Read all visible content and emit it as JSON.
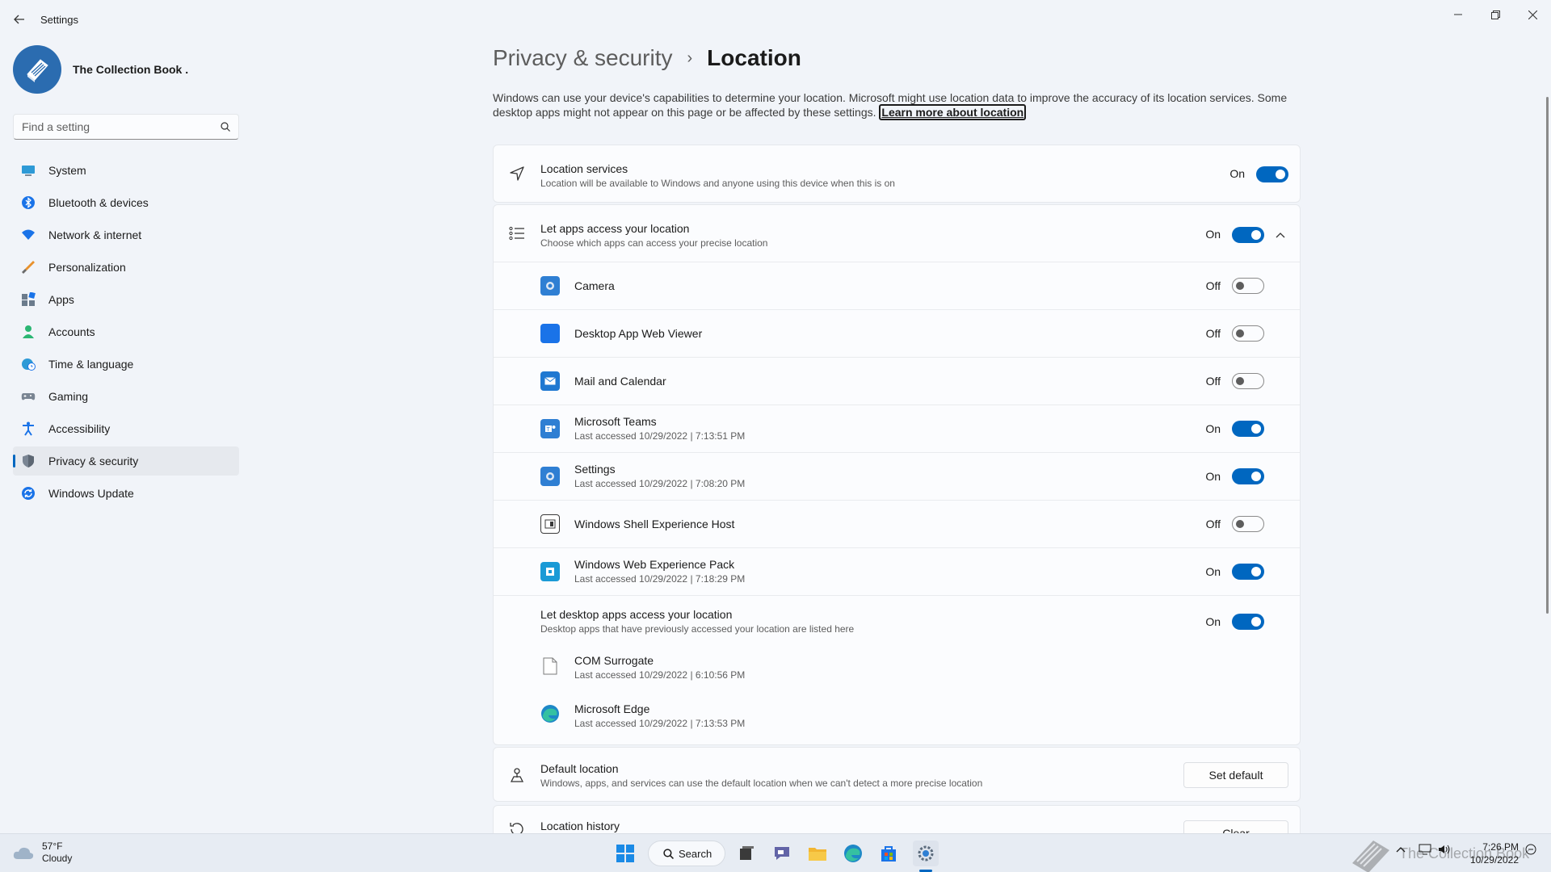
{
  "window": {
    "title": "Settings"
  },
  "profile": {
    "name": "The Collection Book ."
  },
  "search": {
    "placeholder": "Find a setting"
  },
  "sidebar": {
    "items": [
      {
        "label": "System",
        "icon": "monitor-icon"
      },
      {
        "label": "Bluetooth & devices",
        "icon": "bluetooth-icon"
      },
      {
        "label": "Network & internet",
        "icon": "wifi-icon"
      },
      {
        "label": "Personalization",
        "icon": "brush-icon"
      },
      {
        "label": "Apps",
        "icon": "apps-icon"
      },
      {
        "label": "Accounts",
        "icon": "person-icon"
      },
      {
        "label": "Time & language",
        "icon": "globe-clock-icon"
      },
      {
        "label": "Gaming",
        "icon": "gamepad-icon"
      },
      {
        "label": "Accessibility",
        "icon": "accessibility-icon"
      },
      {
        "label": "Privacy & security",
        "icon": "shield-icon",
        "active": true
      },
      {
        "label": "Windows Update",
        "icon": "update-icon"
      }
    ]
  },
  "header": {
    "parent": "Privacy & security",
    "separator": "›",
    "current": "Location"
  },
  "intro": {
    "text": "Windows can use your device's capabilities to determine your location. Microsoft might use location data to improve the accuracy of its location services. Some desktop apps might not appear on this page or be affected by these settings.",
    "link": "Learn more about location"
  },
  "location_services": {
    "title": "Location services",
    "subtitle": "Location will be available to Windows and anyone using this device when this is on",
    "state": "On"
  },
  "apps_access": {
    "title": "Let apps access your location",
    "subtitle": "Choose which apps can access your precise location",
    "state": "On",
    "apps": [
      {
        "name": "Camera",
        "sub": "",
        "state": "Off"
      },
      {
        "name": "Desktop App Web Viewer",
        "sub": "",
        "state": "Off"
      },
      {
        "name": "Mail and Calendar",
        "sub": "",
        "state": "Off"
      },
      {
        "name": "Microsoft Teams",
        "sub": "Last accessed 10/29/2022  |  7:13:51 PM",
        "state": "On"
      },
      {
        "name": "Settings",
        "sub": "Last accessed 10/29/2022  |  7:08:20 PM",
        "state": "On"
      },
      {
        "name": "Windows Shell Experience Host",
        "sub": "",
        "state": "Off"
      },
      {
        "name": "Windows Web Experience Pack",
        "sub": "Last accessed 10/29/2022  |  7:18:29 PM",
        "state": "On"
      }
    ],
    "desktop": {
      "title": "Let desktop apps access your location",
      "subtitle": "Desktop apps that have previously accessed your location are listed here",
      "state": "On",
      "apps": [
        {
          "name": "COM Surrogate",
          "sub": "Last accessed 10/29/2022  |  6:10:56 PM"
        },
        {
          "name": "Microsoft Edge",
          "sub": "Last accessed 10/29/2022  |  7:13:53 PM"
        }
      ]
    }
  },
  "default_location": {
    "title": "Default location",
    "subtitle": "Windows, apps, and services can use the default location when we can't detect a more precise location",
    "button": "Set default"
  },
  "location_history": {
    "title": "Location history",
    "button": "Clear"
  },
  "taskbar": {
    "weather_temp": "57°F",
    "weather_desc": "Cloudy",
    "search_label": "Search",
    "time": "7:26 PM",
    "date": "10/29/2022",
    "watermark": "The Collection Book"
  },
  "colors": {
    "accent": "#0067c0",
    "background": "#f1f4f9",
    "card": "#fbfcfe"
  }
}
